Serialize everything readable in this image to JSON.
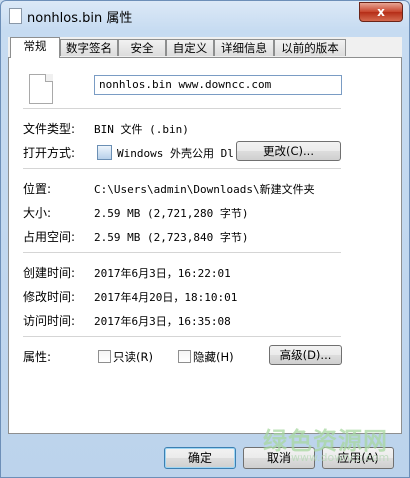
{
  "window": {
    "title": "nonhlos.bin 属性",
    "close_symbol": "x"
  },
  "tabs": [
    {
      "label": "常规",
      "active": true
    },
    {
      "label": "数字签名"
    },
    {
      "label": "安全"
    },
    {
      "label": "自定义"
    },
    {
      "label": "详细信息"
    },
    {
      "label": "以前的版本"
    }
  ],
  "general": {
    "file_name": "nonhlos.bin  www.downcc.com",
    "file_type_label": "文件类型:",
    "file_type_value": "BIN 文件 (.bin)",
    "open_with_label": "打开方式:",
    "open_with_value": "Windows 外壳公用 Dl",
    "change_button": "更改(C)...",
    "location_label": "位置:",
    "location_value": "C:\\Users\\admin\\Downloads\\新建文件夹",
    "size_label": "大小:",
    "size_value": "2.59 MB (2,721,280 字节)",
    "disk_size_label": "占用空间:",
    "disk_size_value": "2.59 MB (2,723,840 字节)",
    "created_label": "创建时间:",
    "created_value": "2017年6月3日，16:22:01",
    "modified_label": "修改时间:",
    "modified_value": "2017年4月20日，18:10:01",
    "accessed_label": "访问时间:",
    "accessed_value": "2017年6月3日，16:35:08",
    "attributes_label": "属性:",
    "readonly_label": "只读(R)",
    "hidden_label": "隐藏(H)",
    "advanced_button": "高级(D)..."
  },
  "footer": {
    "ok": "确定",
    "cancel": "取消",
    "apply": "应用(A)"
  },
  "watermark": {
    "main": "绿色资源网",
    "sub": "www.downcc.com"
  }
}
